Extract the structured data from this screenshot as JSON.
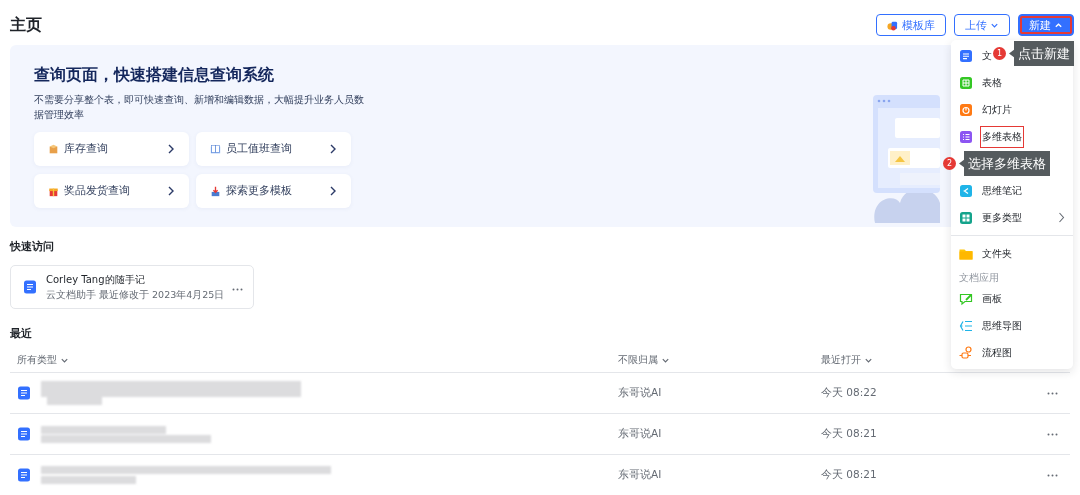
{
  "page_title": "主页",
  "header_buttons": [
    {
      "kind": "template",
      "label": "模板库",
      "highlighted": false
    },
    {
      "kind": "dropdown",
      "label": "上传",
      "expanded": false,
      "highlighted": false
    },
    {
      "kind": "primary",
      "label": "新建",
      "expanded": true,
      "highlighted": true
    }
  ],
  "banner": {
    "title": "查询页面，快速搭建信息查询系统",
    "description": "不需要分享整个表，即可快速查询、新增和编辑数据，大幅提升业务人员数据管理效率",
    "links": [
      {
        "kind": "box",
        "label": "库存查询"
      },
      {
        "kind": "book",
        "label": "员工值班查询"
      },
      {
        "kind": "gift",
        "label": "奖品发货查询"
      },
      {
        "kind": "tray",
        "label": "探索更多模板"
      }
    ]
  },
  "quick_access": {
    "heading": "快速访问",
    "cards": [
      {
        "title": "Corley Tang的随手记",
        "subtitle": "云文档助手 最近修改于 2023年4月25日"
      }
    ]
  },
  "recent": {
    "heading": "最近",
    "columns": [
      "所有类型",
      "不限归属",
      "最近打开"
    ],
    "rows": [
      {
        "owner": "东哥说AI",
        "opened": "今天 08:22"
      },
      {
        "owner": "东哥说AI",
        "opened": "今天 08:21"
      },
      {
        "owner": "东哥说AI",
        "opened": "今天 08:21"
      }
    ]
  },
  "new_menu": {
    "items": [
      {
        "kind": "doc",
        "label": "文",
        "highlighted": false
      },
      {
        "kind": "sheet",
        "label": "表格",
        "highlighted": false
      },
      {
        "kind": "slides",
        "label": "幻灯片",
        "highlighted": false
      },
      {
        "kind": "bitable",
        "label": "多维表格",
        "highlighted": true
      },
      {
        "kind": "covered"
      },
      {
        "kind": "mindnote",
        "label": "思维笔记",
        "highlighted": false
      },
      {
        "kind": "more",
        "label": "更多类型",
        "highlighted": false
      },
      {
        "kind": "divider"
      },
      {
        "kind": "folder",
        "label": "文件夹",
        "highlighted": false
      },
      {
        "kind": "section",
        "label": "文档应用"
      },
      {
        "kind": "board",
        "label": "画板",
        "highlighted": false
      },
      {
        "kind": "mindmap",
        "label": "思维导图",
        "highlighted": false
      },
      {
        "kind": "flowchart",
        "label": "流程图",
        "highlighted": false
      }
    ]
  },
  "annotations": [
    {
      "number": "1",
      "text": "点击新建"
    },
    {
      "number": "2",
      "text": "选择多维表格"
    }
  ]
}
